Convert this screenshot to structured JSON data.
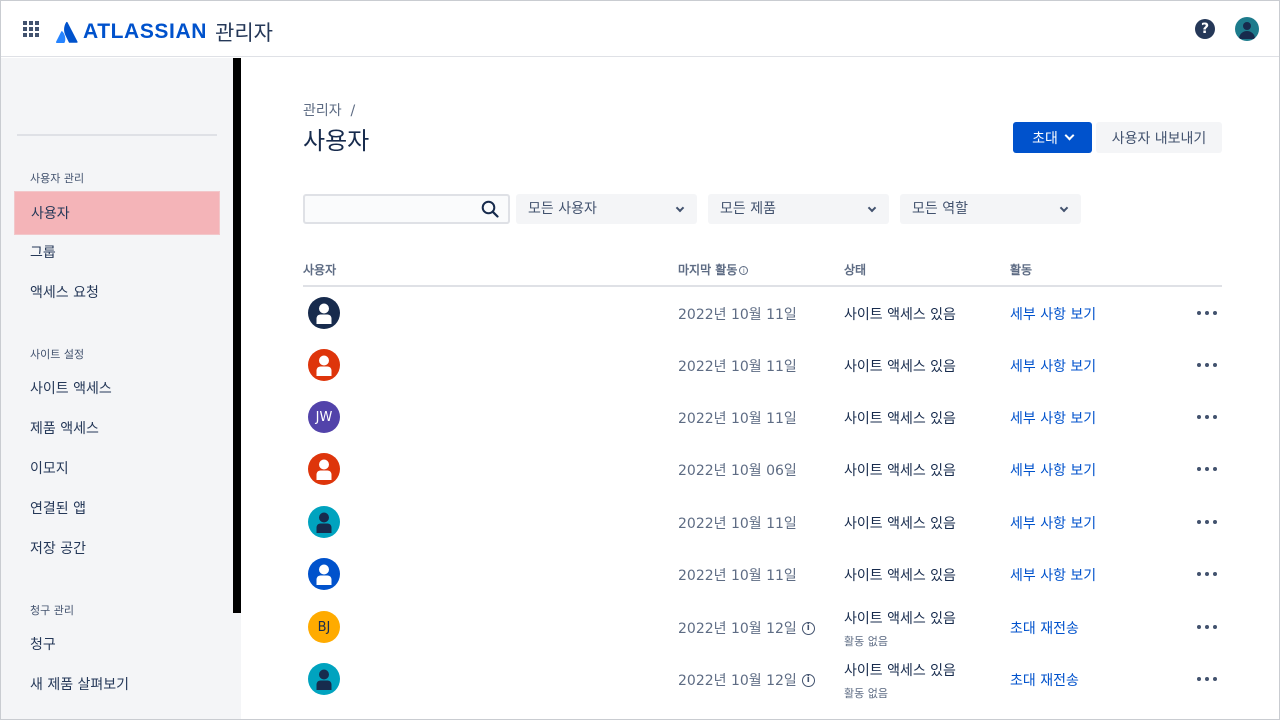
{
  "header": {
    "brand": "ATLASSIAN",
    "product": "관리자"
  },
  "sidebar": {
    "sections": [
      {
        "heading": "사용자 관리",
        "items": [
          "사용자",
          "그룹",
          "액세스 요청"
        ]
      },
      {
        "heading": "사이트 설정",
        "items": [
          "사이트 액세스",
          "제품 액세스",
          "이모지",
          "연결된 앱",
          "저장 공간"
        ]
      },
      {
        "heading": "청구 관리",
        "items": [
          "청구",
          "새 제품 살펴보기"
        ]
      }
    ],
    "active_item": "사용자"
  },
  "main": {
    "breadcrumb": "관리자  /",
    "title": "사용자",
    "invite_label": "초대",
    "export_label": "사용자 내보내기",
    "search": {
      "placeholder": "",
      "value": ""
    },
    "filters": [
      "모든 사용자",
      "모든 제품",
      "모든 역할"
    ],
    "columns": [
      "사용자",
      "마지막 활동",
      "상태",
      "활동"
    ],
    "rows": [
      {
        "avatar": {
          "type": "person",
          "bg": "#172b4d",
          "fg": "#ffffff"
        },
        "date": "2022년 10월 11일",
        "status": "사이트 액세스 있음",
        "sub": "",
        "action": "세부 사항 보기",
        "info": false
      },
      {
        "avatar": {
          "type": "person",
          "bg": "#de350b",
          "fg": "#ffffff"
        },
        "date": "2022년 10월 11일",
        "status": "사이트 액세스 있음",
        "sub": "",
        "action": "세부 사항 보기",
        "info": false
      },
      {
        "avatar": {
          "type": "initials",
          "text": "JW",
          "bg": "#5243aa",
          "fg": "#ffffff"
        },
        "date": "2022년 10월 11일",
        "status": "사이트 액세스 있음",
        "sub": "",
        "action": "세부 사항 보기",
        "info": false
      },
      {
        "avatar": {
          "type": "person",
          "bg": "#de350b",
          "fg": "#ffffff"
        },
        "date": "2022년 10월 06일",
        "status": "사이트 액세스 있음",
        "sub": "",
        "action": "세부 사항 보기",
        "info": false
      },
      {
        "avatar": {
          "type": "person",
          "bg": "#00a3bf",
          "fg": "#172b4d"
        },
        "date": "2022년 10월 11일",
        "status": "사이트 액세스 있음",
        "sub": "",
        "action": "세부 사항 보기",
        "info": false
      },
      {
        "avatar": {
          "type": "person",
          "bg": "#0052cc",
          "fg": "#ffffff"
        },
        "date": "2022년 10월 11일",
        "status": "사이트 액세스 있음",
        "sub": "",
        "action": "세부 사항 보기",
        "info": false
      },
      {
        "avatar": {
          "type": "initials",
          "text": "BJ",
          "bg": "#ffab00",
          "fg": "#172b4d"
        },
        "date": "2022년 10월 12일",
        "status": "사이트 액세스 있음",
        "sub": "활동 없음",
        "action": "초대 재전송",
        "info": true
      },
      {
        "avatar": {
          "type": "person",
          "bg": "#00a3bf",
          "fg": "#172b4d"
        },
        "date": "2022년 10월 12일",
        "status": "사이트 액세스 있음",
        "sub": "활동 없음",
        "action": "초대 재전송",
        "info": true
      }
    ]
  },
  "colors": {
    "primary": "#0052cc",
    "sidebar_bg": "#f4f5f7",
    "active_item": "#f4b4b8",
    "text": "#172b4d"
  }
}
